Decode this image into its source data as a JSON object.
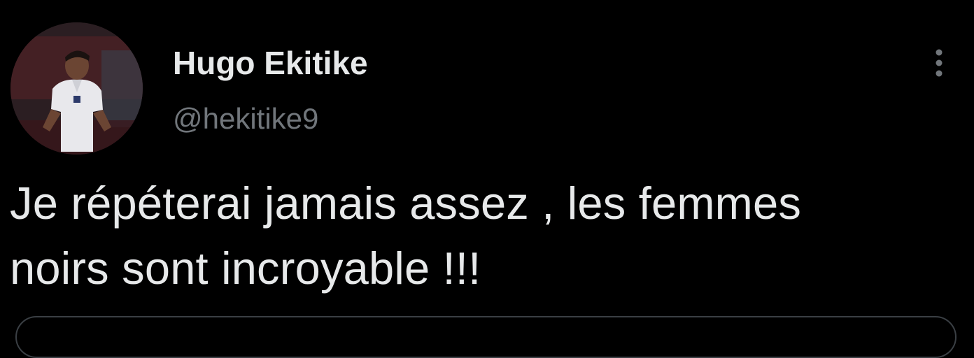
{
  "tweet": {
    "author": {
      "display_name": "Hugo Ekitike",
      "handle": "@hekitike9",
      "avatar_icon": "user-avatar-photo"
    },
    "text": "Je répéterai jamais assez , les femmes\nnoirs sont incroyable !!!",
    "more_icon": "more-vertical-icon"
  },
  "colors": {
    "background": "#000000",
    "text_primary": "#e7e9ea",
    "text_secondary": "#71767b",
    "border": "#3a3f44"
  }
}
